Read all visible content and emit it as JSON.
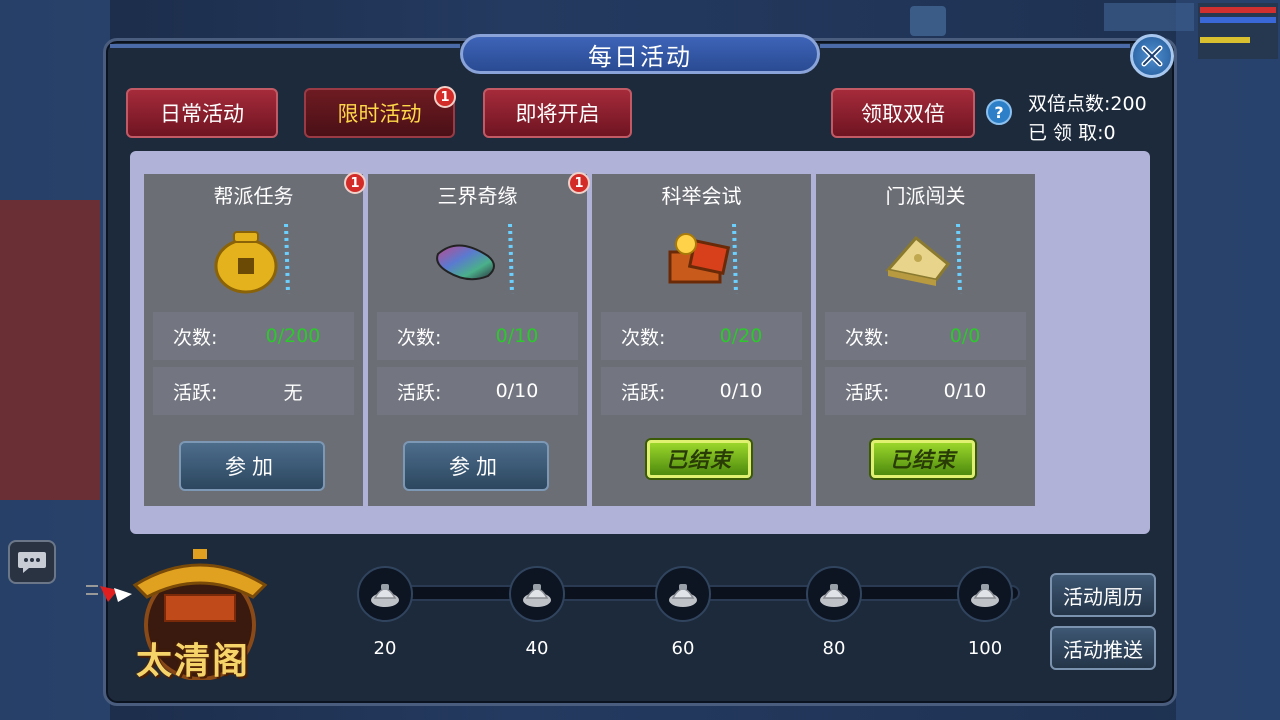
{
  "window": {
    "title": "每日活动"
  },
  "tabs": [
    {
      "label": "日常活动",
      "active": false,
      "badge": ""
    },
    {
      "label": "限时活动",
      "active": true,
      "badge": "1"
    },
    {
      "label": "即将开启",
      "active": false,
      "badge": ""
    }
  ],
  "double": {
    "claim_label": "领取双倍",
    "help_symbol": "?",
    "points_text": "双倍点数:200",
    "claimed_text": "已 领 取:0"
  },
  "activities": [
    {
      "title": "帮派任务",
      "badge": "1",
      "icon": "gold-coin-icon",
      "count_label": "次数:",
      "count_value": "0/200",
      "active_label": "活跃:",
      "active_value": "无",
      "action": "参加",
      "ended": false
    },
    {
      "title": "三界奇缘",
      "badge": "1",
      "icon": "rainbow-stone-icon",
      "count_label": "次数:",
      "count_value": "0/10",
      "active_label": "活跃:",
      "active_value": "0/10",
      "action": "参加",
      "ended": false
    },
    {
      "title": "科举会试",
      "badge": "",
      "icon": "treasure-box-icon",
      "count_label": "次数:",
      "count_value": "0/20",
      "active_label": "活跃:",
      "active_value": "0/10",
      "action": "已结束",
      "ended": true
    },
    {
      "title": "门派闯关",
      "badge": "",
      "icon": "gold-cheese-icon",
      "count_label": "次数:",
      "count_value": "0/0",
      "active_label": "活跃:",
      "active_value": "0/10",
      "action": "已结束",
      "ended": true
    }
  ],
  "progress": {
    "milestones": [
      "20",
      "40",
      "60",
      "80",
      "100"
    ],
    "current": 0
  },
  "side_buttons": {
    "calendar": "活动周历",
    "push": "活动推送"
  },
  "pavilion": {
    "name": "太清阁"
  },
  "colors": {
    "count_green": "#2cc92c",
    "tab_red": "#a52b3a",
    "active_tab_text": "#ffd84a"
  }
}
